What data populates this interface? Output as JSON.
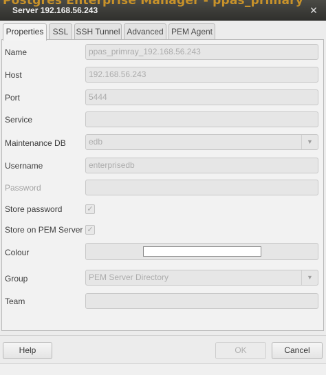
{
  "window": {
    "background_text": "Postgres Enterprise Manager - ppas_primary",
    "title": "Server 192.168.56.243",
    "close_glyph": "✕"
  },
  "tabs": [
    {
      "label": "Properties",
      "active": true
    },
    {
      "label": "SSL"
    },
    {
      "label": "SSH Tunnel"
    },
    {
      "label": "Advanced"
    },
    {
      "label": "PEM Agent"
    }
  ],
  "form": {
    "name": {
      "label": "Name",
      "value": "ppas_primray_192.168.56.243"
    },
    "host": {
      "label": "Host",
      "value": "192.168.56.243"
    },
    "port": {
      "label": "Port",
      "value": "5444"
    },
    "service": {
      "label": "Service",
      "value": ""
    },
    "maintenance_db": {
      "label": "Maintenance DB",
      "value": "edb"
    },
    "username": {
      "label": "Username",
      "value": "enterprisedb"
    },
    "password": {
      "label": "Password",
      "value": ""
    },
    "store_password": {
      "label": "Store password",
      "checked": true
    },
    "store_on_pem": {
      "label": "Store on PEM Server",
      "checked": true
    },
    "colour": {
      "label": "Colour",
      "value": "#ffffff"
    },
    "group": {
      "label": "Group",
      "value": "PEM Server Directory"
    },
    "team": {
      "label": "Team",
      "value": ""
    }
  },
  "buttons": {
    "help": "Help",
    "ok": "OK",
    "cancel": "Cancel"
  },
  "glyphs": {
    "check": "✓",
    "dropdown": "▼"
  }
}
